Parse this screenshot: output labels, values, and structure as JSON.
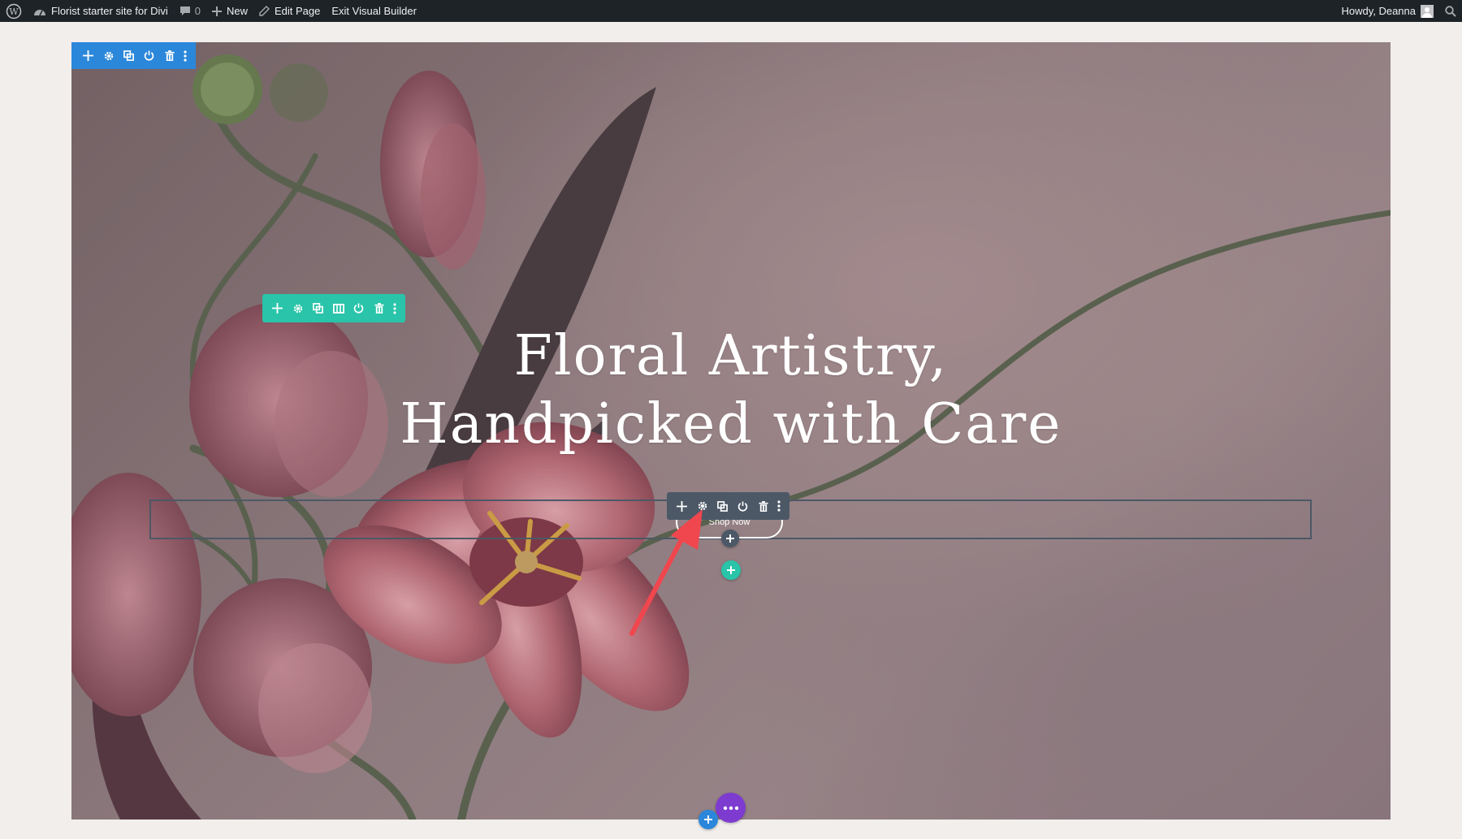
{
  "admin_bar": {
    "site_name": "Florist starter site for Divi",
    "comment_count": "0",
    "new_label": "New",
    "edit_page_label": "Edit Page",
    "exit_builder_label": "Exit Visual Builder",
    "greeting": "Howdy, Deanna"
  },
  "hero": {
    "title_line1": "Floral Artistry,",
    "title_line2": "Handpicked with Care",
    "button_label": "Shop Now"
  },
  "builder": {
    "section_toolbar_icons": [
      "move-icon",
      "gear-icon",
      "duplicate-icon",
      "power-icon",
      "trash-icon",
      "more-icon"
    ],
    "row_toolbar_icons": [
      "move-icon",
      "gear-icon",
      "duplicate-icon",
      "columns-icon",
      "power-icon",
      "trash-icon",
      "more-icon"
    ],
    "module_toolbar_icons": [
      "move-icon",
      "gear-icon",
      "duplicate-icon",
      "power-icon",
      "trash-icon",
      "more-icon"
    ],
    "colors": {
      "section": "#2b87da",
      "row": "#29c4a9",
      "module": "#4c5866",
      "page_settings": "#7e3bd0",
      "annotation_arrow": "#f0464e"
    }
  }
}
